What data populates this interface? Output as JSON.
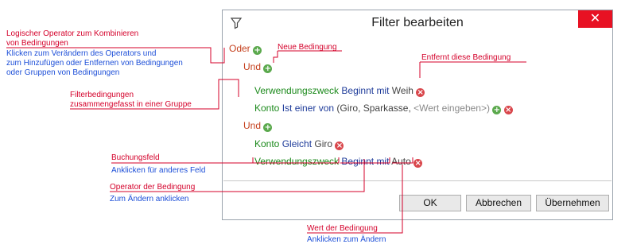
{
  "dialog": {
    "title": "Filter bearbeiten",
    "close_glyph": "✕",
    "buttons": {
      "ok": "OK",
      "cancel": "Abbrechen",
      "apply": "Übernehmen"
    }
  },
  "filter_tree": {
    "root_operator": "Oder",
    "group1": {
      "operator": "Und",
      "cond1": {
        "field": "Verwendungszweck",
        "condition": "Beginnt mit",
        "value": "Weih"
      },
      "cond2": {
        "field": "Konto",
        "condition": "Ist einer von",
        "values": "(Giro, Sparkasse,",
        "placeholder": "<Wert eingeben>)"
      }
    },
    "group2": {
      "operator": "Und",
      "cond1": {
        "field": "Konto",
        "condition": "Gleicht",
        "value": "Giro"
      },
      "cond2": {
        "field": "Verwendungszweck",
        "condition": "Beginnt mit",
        "value": "Auto"
      }
    }
  },
  "annotations": {
    "logic_op_red": [
      "Logischer Operator zum Kombinieren",
      "von Bedingungen"
    ],
    "logic_op_blue": [
      "Klicken zum Verändern des Operators und",
      "zum Hinzufügen oder Entfernen von Bedingungen",
      "oder Gruppen von Bedingungen"
    ],
    "new_condition": "Neue Bedingung",
    "remove_condition": "Entfernt diese Bedingung",
    "group_red": [
      "Filterbedingungen",
      "zusammengefasst in einer Gruppe"
    ],
    "field_red": "Buchungsfeld",
    "field_blue": "Anklicken für anderes Feld",
    "operator_red": "Operator der Bedingung",
    "operator_blue": "Zum Ändern anklicken",
    "value_red": "Wert der Bedingung",
    "value_blue": "Anklicken zum Ändern"
  },
  "colors": {
    "operator": "#c5411e",
    "field": "#1c8a1c",
    "condition": "#1f3c9a",
    "add": "#5ba94d",
    "remove": "#d9474c",
    "annotation_red": "#d4002a",
    "annotation_blue": "#1d4fd8",
    "close": "#e81123"
  },
  "icons": {
    "filter": "filter-icon",
    "add": "plus-circle-icon",
    "remove": "minus-circle-icon",
    "close": "close-icon"
  }
}
